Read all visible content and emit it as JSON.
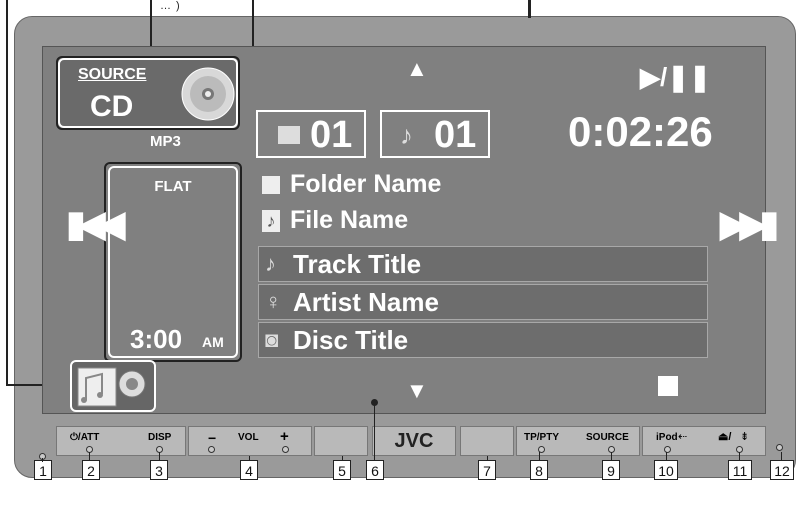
{
  "header": {
    "text": "…                                                      )"
  },
  "source_box": {
    "label": "SOURCE",
    "value": "CD",
    "format": "MP3"
  },
  "eq_box": {
    "mode": "FLAT",
    "time": "3:00",
    "ampm": "AM"
  },
  "folder_num": "01",
  "track_num": "01",
  "elapsed": "0:02:26",
  "folder_name": "Folder Name",
  "file_name": "File Name",
  "track_title": "Track Title",
  "artist_name": "Artist Name",
  "disc_title": "Disc Title",
  "buttons": {
    "att": "⏻/ATT",
    "disp": "DISP",
    "vol": "VOL",
    "vol_minus": "−",
    "vol_plus": "+",
    "brand": "JVC",
    "tp_pty": "TP/PTY",
    "source": "SOURCE",
    "ipod": "iPod",
    "eject": "⏏/"
  },
  "callouts": [
    "1",
    "2",
    "3",
    "4",
    "5",
    "6",
    "7",
    "8",
    "9",
    "10",
    "11",
    "12"
  ]
}
